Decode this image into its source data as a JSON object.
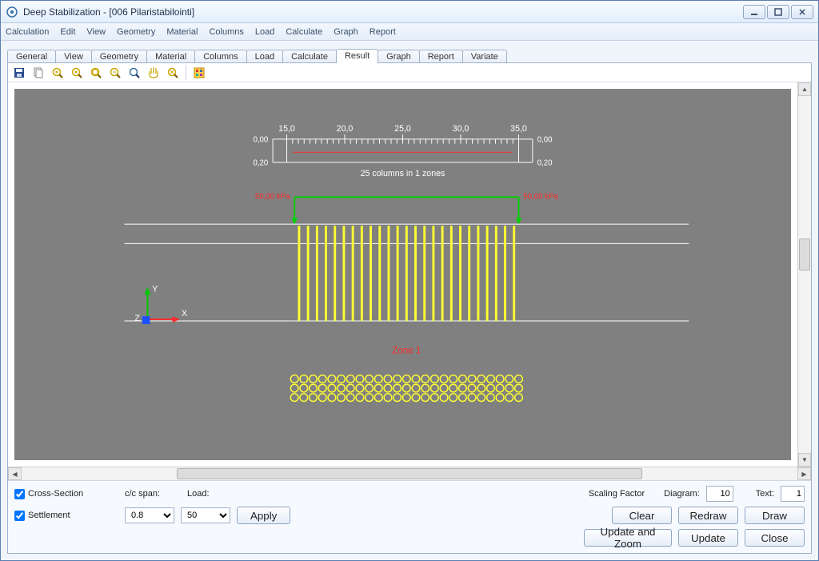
{
  "title": "Deep Stabilization - [006 Pilaristabilointi]",
  "menu": [
    "Calculation",
    "Edit",
    "View",
    "Geometry",
    "Material",
    "Columns",
    "Load",
    "Calculate",
    "Graph",
    "Report"
  ],
  "tabs": [
    "General",
    "View",
    "Geometry",
    "Material",
    "Columns",
    "Load",
    "Calculate",
    "Result",
    "Graph",
    "Report",
    "Variate"
  ],
  "active_tab": "Result",
  "toolbar_icons": [
    "save-icon",
    "copy-icon",
    "zoom-in-icon",
    "zoom-extents-icon",
    "zoom-window-icon",
    "zoom-out-icon",
    "zoom-previous-icon",
    "pan-icon",
    "zoom-reset-icon",
    "divider",
    "settings-icon"
  ],
  "bottom": {
    "cross_section_label": "Cross-Section",
    "settlement_label": "Settlement",
    "cc_span_label": "c/c span:",
    "cc_span_value": "0.8",
    "load_label": "Load:",
    "load_value": "50",
    "apply": "Apply",
    "scaling_factor_label": "Scaling Factor",
    "diagram_label": "Diagram:",
    "diagram_value": "10",
    "text_label": "Text:",
    "text_value": "1",
    "clear": "Clear",
    "redraw": "Redraw",
    "draw": "Draw",
    "update_zoom": "Update and Zoom",
    "update": "Update",
    "close": "Close"
  },
  "chart_data": {
    "ruler_ticks": [
      "15,0",
      "20,0",
      "25,0",
      "30,0",
      "35,0"
    ],
    "ruler_left_labels": [
      "0,00",
      "0,20"
    ],
    "ruler_right_labels": [
      "0,00",
      "0,20"
    ],
    "ruler_subtitle": "25 columns in 1 zones",
    "load_left": "50,00 kPa",
    "load_right": "50,00 kPa",
    "zone_label": "Zone 1",
    "axis_x": "X",
    "axis_y": "Y",
    "axis_z": "Z",
    "column_count": 25,
    "plan_rows": 3,
    "plan_cols": 25
  }
}
